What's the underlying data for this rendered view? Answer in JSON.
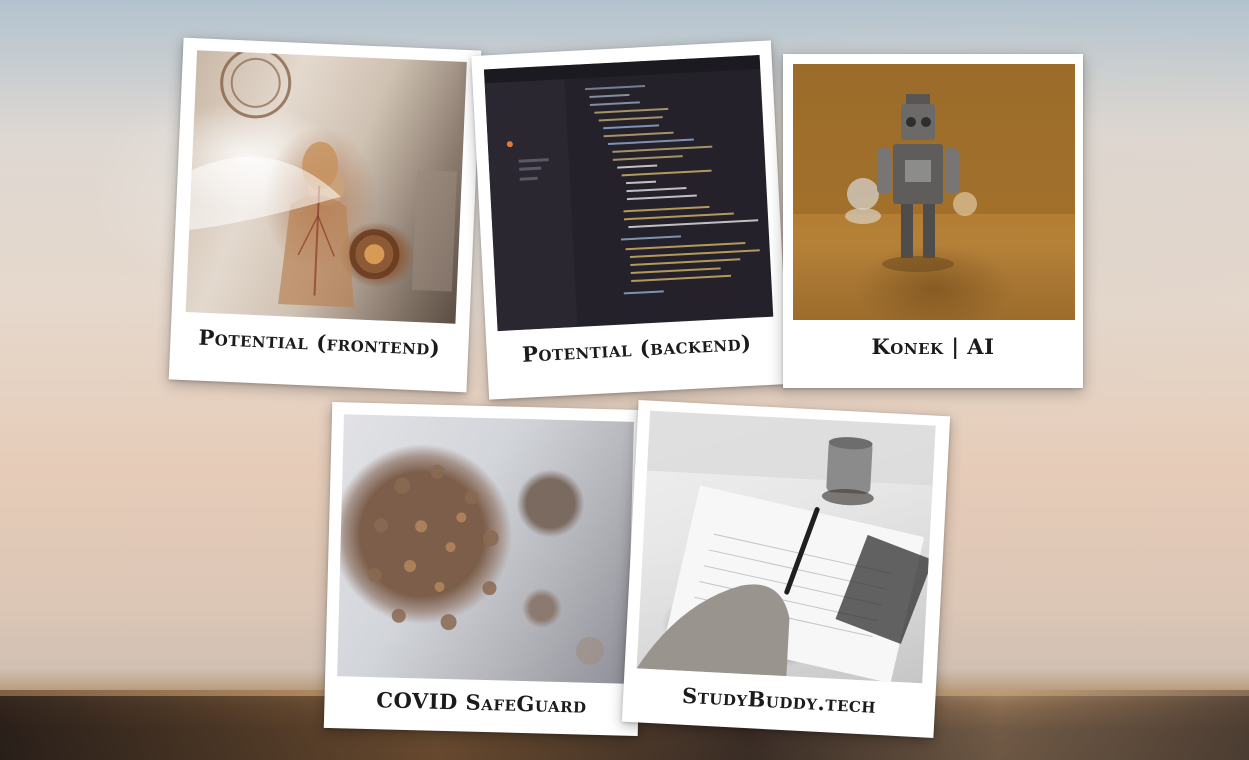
{
  "projects": [
    {
      "title": "Potential (frontend)"
    },
    {
      "title": "Potential (backend)"
    },
    {
      "title": "Konek | AI"
    },
    {
      "title": "COVID SafeGuard"
    },
    {
      "title": "StudyBuddy.tech"
    }
  ],
  "colors": {
    "card_background": "#ffffff",
    "caption_text": "#1b1b1b",
    "code_editor_background": "#24212a"
  }
}
